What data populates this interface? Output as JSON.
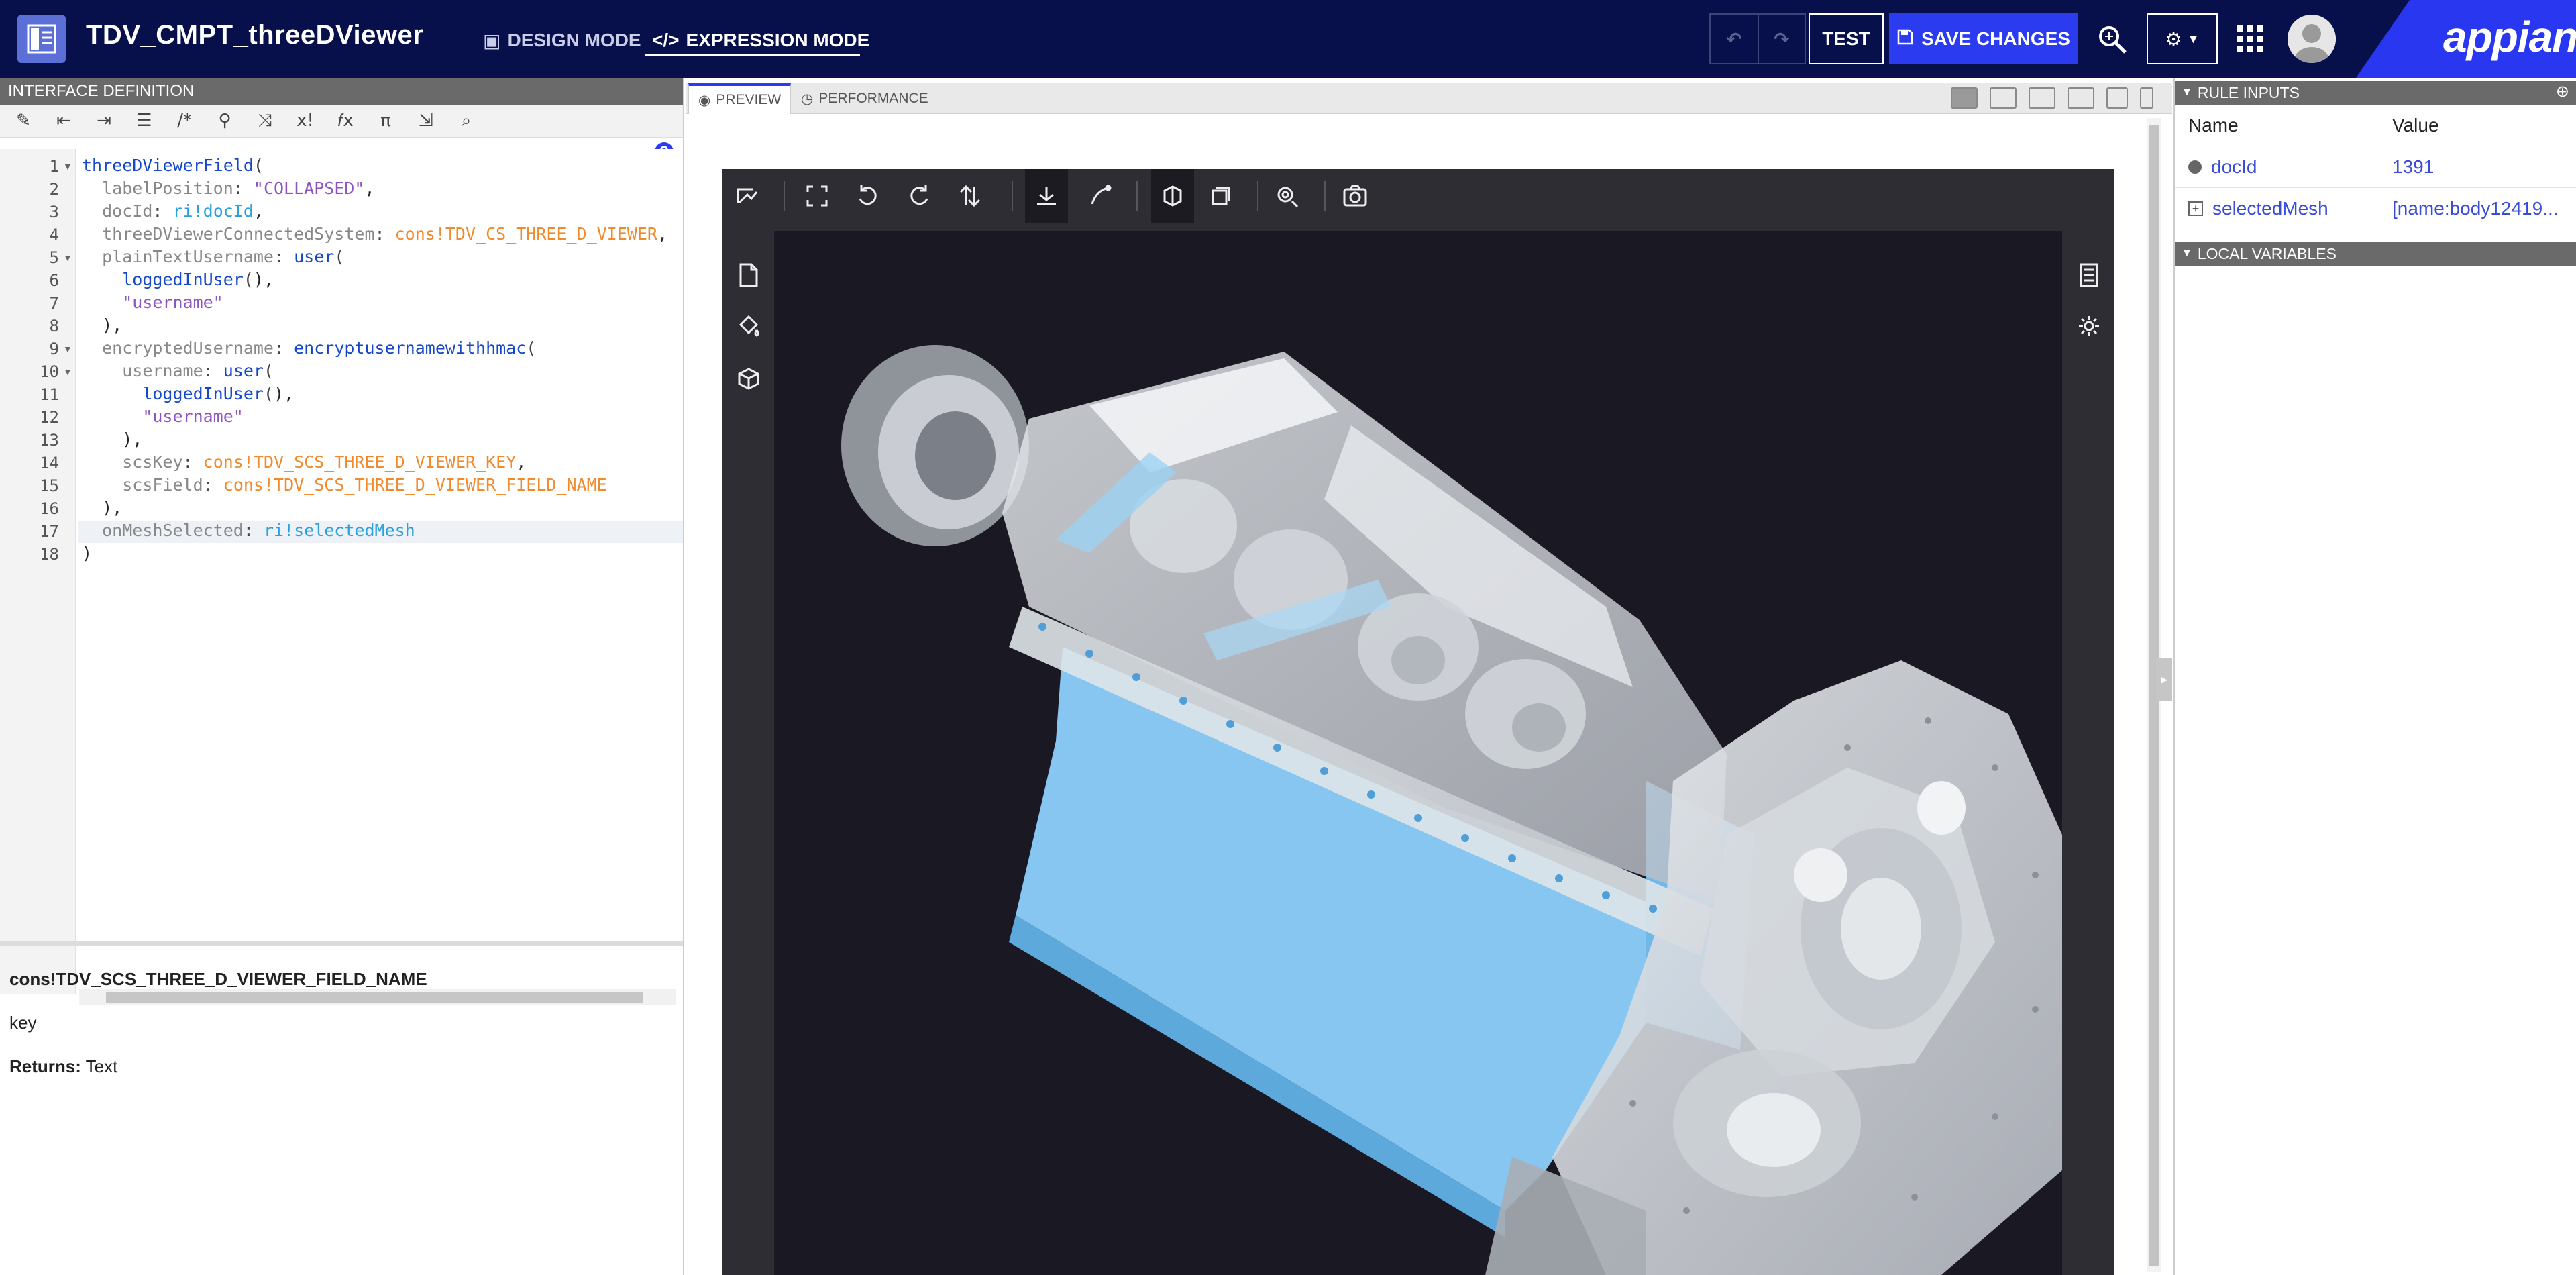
{
  "header": {
    "app_title": "TDV_CMPT_threeDViewer",
    "design_mode_label": "DESIGN MODE",
    "expression_mode_label": "EXPRESSION MODE",
    "test_label": "TEST",
    "save_label": "SAVE CHANGES",
    "logo_text": "appian",
    "colors": {
      "header_bg": "#07104a",
      "save_bg": "#2b3cf0",
      "logo_bg": "#2a37f0"
    }
  },
  "left_panel": {
    "section_title": "INTERFACE DEFINITION",
    "help_label": "?",
    "code_lines": [
      "threeDViewerField(",
      "  labelPosition: \"COLLAPSED\",",
      "  docId: ri!docId,",
      "  threeDViewerConnectedSystem: cons!TDV_CS_THREE_D_VIEWER,",
      "  plainTextUsername: user(",
      "    loggedInUser(),",
      "    \"username\"",
      "  ),",
      "  encryptedUsername: encryptusernamewithhmac(",
      "    username: user(",
      "      loggedInUser(),",
      "      \"username\"",
      "    ),",
      "    scsKey: cons!TDV_SCS_THREE_D_VIEWER_KEY,",
      "    scsField: cons!TDV_SCS_THREE_D_VIEWER_FIELD_NAME",
      "  ),",
      "  onMeshSelected: ri!selectedMesh",
      ")"
    ],
    "line_numbers": [
      "1",
      "2",
      "3",
      "4",
      "5",
      "6",
      "7",
      "8",
      "9",
      "10",
      "11",
      "12",
      "13",
      "14",
      "15",
      "16",
      "17",
      "18"
    ],
    "doc": {
      "title": "cons!TDV_SCS_THREE_D_VIEWER_FIELD_NAME",
      "param": "key",
      "returns_label": "Returns:",
      "returns_value": "Text"
    }
  },
  "center_panel": {
    "tabs": [
      {
        "label": "PREVIEW"
      },
      {
        "label": "PERFORMANCE"
      }
    ]
  },
  "right_panel": {
    "rule_inputs_title": "RULE INPUTS",
    "col_name": "Name",
    "col_value": "Value",
    "inputs": [
      {
        "name": "docId",
        "value": "1391"
      },
      {
        "name": "selectedMesh",
        "value": "[name:body12419..."
      }
    ],
    "local_variables_title": "LOCAL VARIABLES"
  }
}
